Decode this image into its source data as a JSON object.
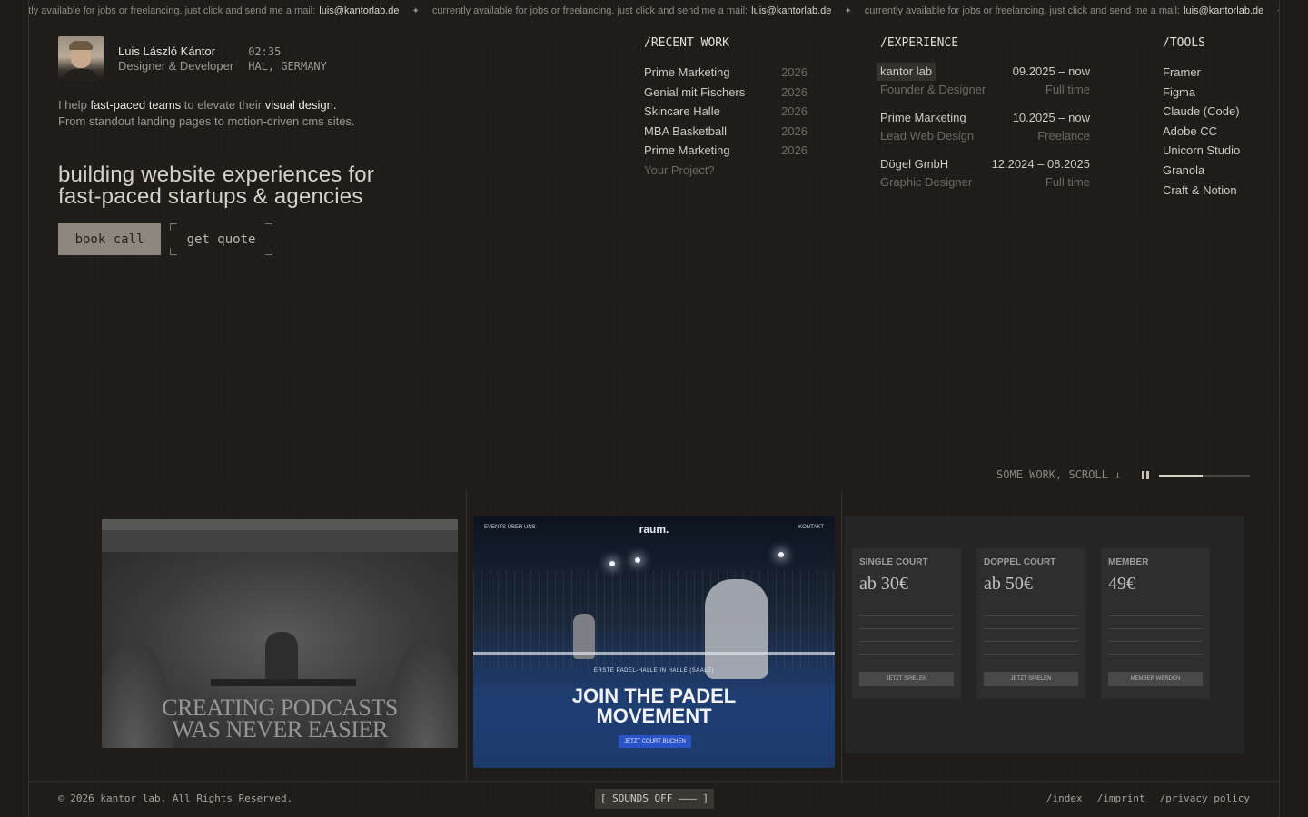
{
  "ticker": {
    "text": "currently available for jobs or freelancing. just click and send me a mail:",
    "email": "luis@kantorlab.de",
    "separator": "✦"
  },
  "profile": {
    "name": "Luis László Kántor",
    "role": "Designer & Developer",
    "time": "02:35",
    "location": "HAL, GERMANY"
  },
  "intro": {
    "p1": "I help",
    "h1": "fast-paced teams",
    "p2": "to elevate their",
    "h2": "visual design.",
    "line2": "From standout landing pages to motion-driven cms sites."
  },
  "headline": {
    "line1": "building website experiences for",
    "line2": "fast-paced startups & agencies"
  },
  "buttons": {
    "book": "book call",
    "quote": "get quote"
  },
  "recent_work": {
    "heading": "/RECENT WORK",
    "items": [
      {
        "title": "Prime Marketing",
        "year": "2026"
      },
      {
        "title": "Genial mit Fischers",
        "year": "2026"
      },
      {
        "title": "Skincare Halle",
        "year": "2026"
      },
      {
        "title": "MBA Basketball",
        "year": "2026"
      },
      {
        "title": "Prime Marketing",
        "year": "2026"
      }
    ],
    "cta": "Your Project?"
  },
  "experience": {
    "heading": "/EXPERIENCE",
    "items": [
      {
        "company": "kantor lab",
        "dates": "09.2025 – now",
        "role": "Founder & Designer",
        "type": "Full time"
      },
      {
        "company": "Prime Marketing",
        "dates": "10.2025 – now",
        "role": "Lead Web Design",
        "type": "Freelance"
      },
      {
        "company": "Dögel GmbH",
        "dates": "12.2024 – 08.2025",
        "role": "Graphic Designer",
        "type": "Full time"
      }
    ]
  },
  "tools": {
    "heading": "/TOOLS",
    "items": [
      "Framer",
      "Figma",
      "Claude (Code)",
      "Adobe CC",
      "Unicorn Studio",
      "Granola",
      "Craft & Notion"
    ]
  },
  "gallery": {
    "hint": "SOME WORK, SCROLL ↓",
    "progress": 0.48,
    "shot1": {
      "title_l1": "CREATING PODCASTS",
      "title_l2": "WAS NEVER EASIER"
    },
    "shot2": {
      "brand": "raum.",
      "kicker": "ERSTE PADEL-HALLE IN HALLE (SAALE)",
      "title_l1": "JOIN THE PADEL",
      "title_l2": "MOVEMENT",
      "cta": "JETZT COURT BUCHEN",
      "nav_left": "EVENTS   ÜBER UNS",
      "nav_right": "KONTAKT"
    },
    "shot3": {
      "cards": [
        {
          "title": "SINGLE COURT",
          "price": "ab 30€",
          "button": "JETZT SPIELEN"
        },
        {
          "title": "DOPPEL COURT",
          "price": "ab 50€",
          "button": "JETZT SPIELEN"
        },
        {
          "title": "MEMBER",
          "price": "49€",
          "button": "MEMBER WERDEN"
        }
      ]
    }
  },
  "footer": {
    "copyright": "© 2026 kantor lab. All Rights Reserved.",
    "sound": "[ SOUNDS OFF ––– ]",
    "links": [
      "/index",
      "/imprint",
      "/privacy policy"
    ]
  }
}
